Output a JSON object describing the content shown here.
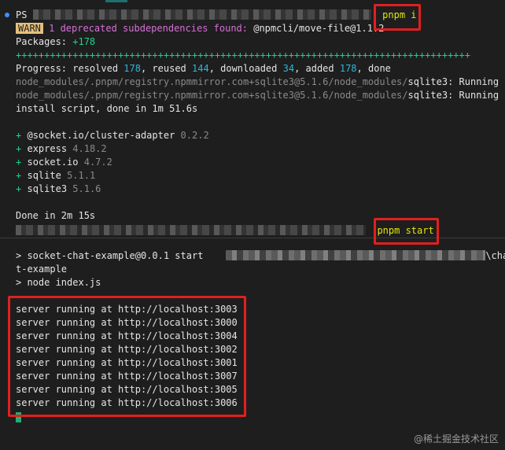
{
  "prompt1": {
    "ps": "PS",
    "command": "pnpm i"
  },
  "warn": {
    "badge": "WARN",
    "message": " 1 deprecated subdependencies found: ",
    "dep": "@npmcli/move-file@1.1.2"
  },
  "packages": {
    "label": "Packages: ",
    "count": "+178"
  },
  "progress_bar": "++++++++++++++++++++++++++++++++++++++++++++++++++++++++++++++++++++++++++++++++",
  "progress": {
    "prefix": "Progress: resolved ",
    "resolved": "178",
    "mid1": ", reused ",
    "reused": "144",
    "mid2": ", downloaded ",
    "downloaded": "34",
    "mid3": ", added ",
    "added": "178",
    "suffix": ", done"
  },
  "install_lines": [
    {
      "path": "node_modules/.pnpm/registry.npmmirror.com+sqlite3@5.1.6/node_modules/",
      "pkg": "sqlite3",
      "status": ": Running"
    },
    {
      "path": "node_modules/.pnpm/registry.npmmirror.com+sqlite3@5.1.6/node_modules/",
      "pkg": "sqlite3",
      "status": ": Running"
    }
  ],
  "install_done": "install script, done in 1m 51.6s",
  "deps": [
    {
      "plus": "+",
      "name": "@socket.io/cluster-adapter",
      "version": "0.2.2"
    },
    {
      "plus": "+",
      "name": "express",
      "version": "4.18.2"
    },
    {
      "plus": "+",
      "name": "socket.io",
      "version": "4.7.2"
    },
    {
      "plus": "+",
      "name": "sqlite",
      "version": "5.1.1"
    },
    {
      "plus": "+",
      "name": "sqlite3",
      "version": "5.1.6"
    }
  ],
  "done": "Done in 2m 15s",
  "prompt2": {
    "command": "pnpm start"
  },
  "start_line": {
    "prefix": "> socket-chat-example@0.0.1 start",
    "tail": "\\cha"
  },
  "start_wrap": "t-example",
  "node_line": "> node index.js",
  "servers": [
    "server running at http://localhost:3003",
    "server running at http://localhost:3000",
    "server running at http://localhost:3004",
    "server running at http://localhost:3002",
    "server running at http://localhost:3001",
    "server running at http://localhost:3007",
    "server running at http://localhost:3005",
    "server running at http://localhost:3006"
  ],
  "watermark": "@稀土掘金技术社区",
  "colors": {
    "highlight_box": "#e02020",
    "success": "#23d18b",
    "warn": "#e5c07b",
    "command": "#e5e510"
  }
}
